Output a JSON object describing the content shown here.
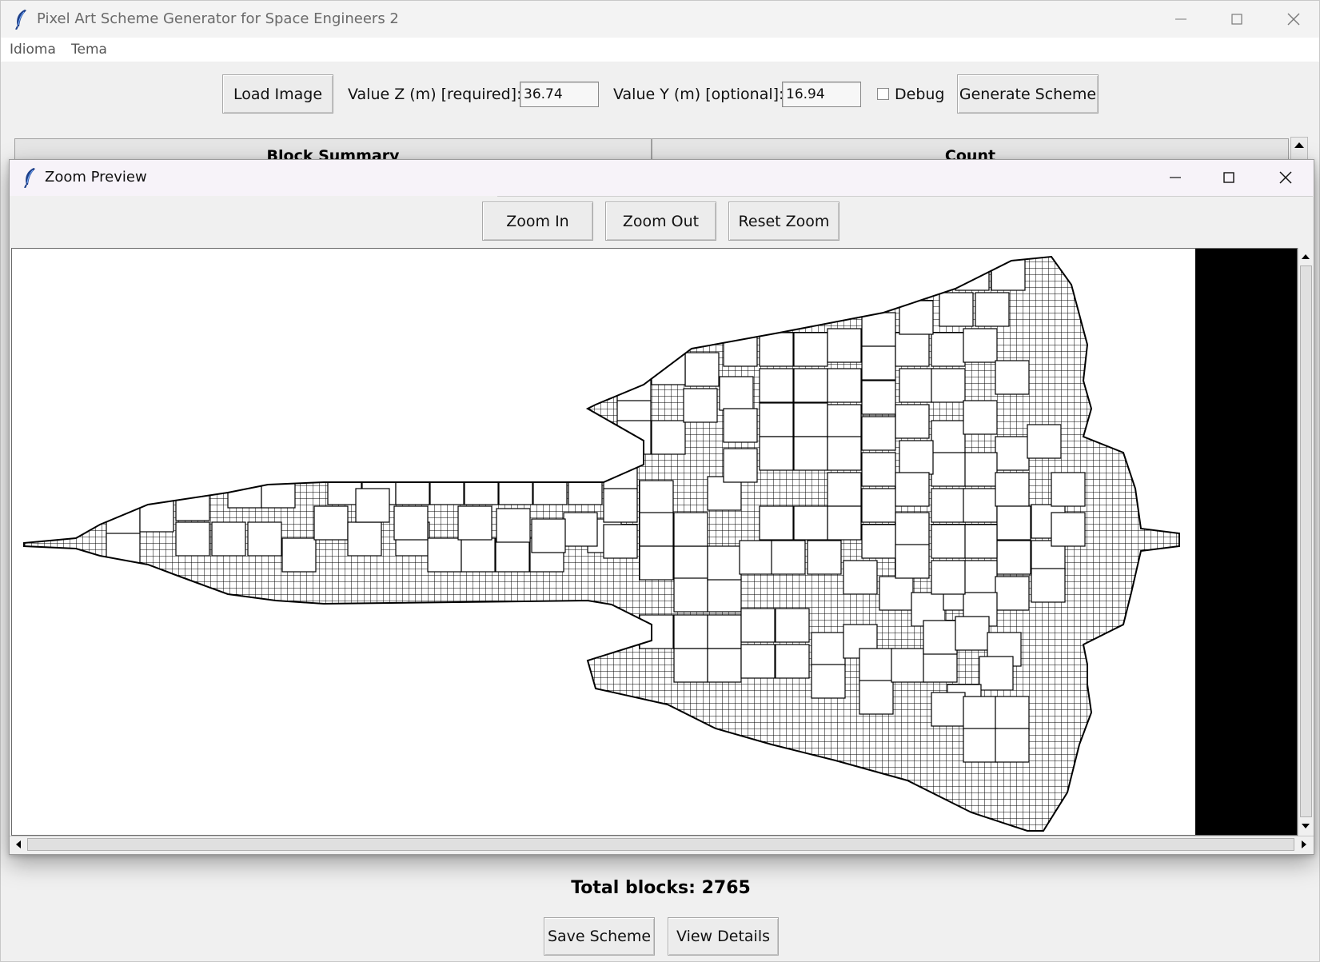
{
  "main_window": {
    "title": "Pixel Art Scheme Generator for Space Engineers 2",
    "menu": [
      "Idioma",
      "Tema"
    ],
    "toolbar": {
      "load_label": "Load Image",
      "z_label": "Value Z (m) [required]:",
      "z_value": "36.74",
      "y_label": "Value Y (m) [optional]:",
      "y_value": "16.94",
      "debug_label": "Debug",
      "debug_checked": false,
      "generate_label": "Generate Scheme"
    },
    "table": {
      "columns": [
        "Block Summary",
        "Count"
      ]
    },
    "total_label": "Total blocks: 2765",
    "save_label": "Save Scheme",
    "details_label": "View Details"
  },
  "zoom_window": {
    "title": "Zoom Preview",
    "zoom_in_label": "Zoom In",
    "zoom_out_label": "Zoom Out",
    "reset_label": "Reset Zoom"
  },
  "preview": {
    "subject": "block-scheme-aircraft",
    "background_color": "#ffffff",
    "grid_color": "#000000",
    "side_band_color": "#000000"
  }
}
